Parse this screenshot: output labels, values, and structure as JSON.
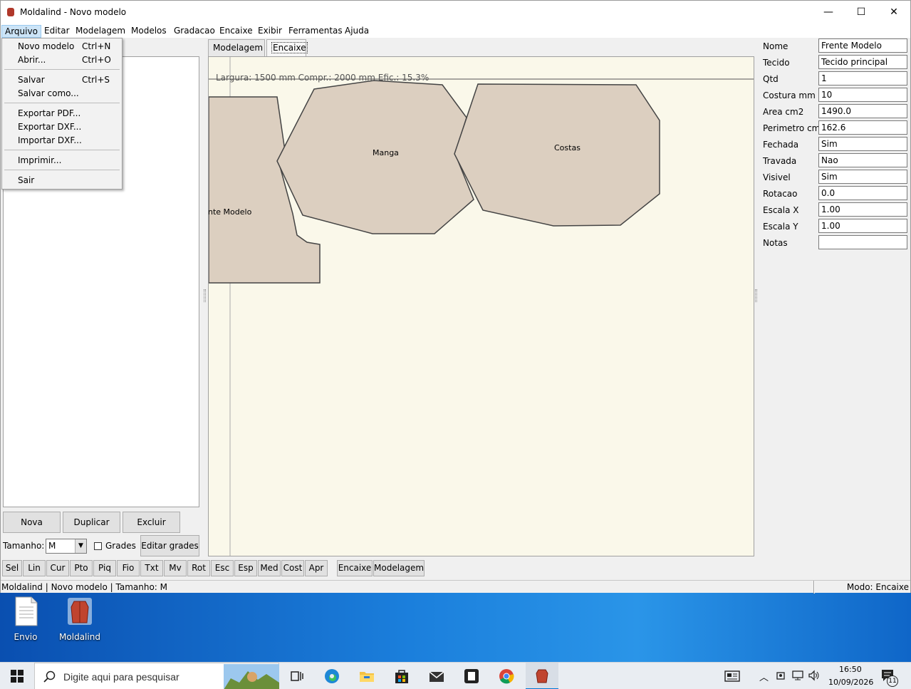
{
  "window": {
    "title": "Moldalind - Novo modelo",
    "minimize": "—",
    "maximize": "☐",
    "close": "✕"
  },
  "menubar": [
    "Arquivo",
    "Editar",
    "Modelagem",
    "Modelos",
    "Gradacao",
    "Encaixe",
    "Exibir",
    "Ferramentas",
    "Ajuda"
  ],
  "file_menu": {
    "items": [
      {
        "label": "Novo modelo",
        "shortcut": "Ctrl+N"
      },
      {
        "label": "Abrir...",
        "shortcut": "Ctrl+O"
      },
      {
        "label": "Salvar",
        "shortcut": "Ctrl+S"
      },
      {
        "label": "Salvar como...",
        "shortcut": ""
      },
      {
        "label": "Exportar PDF...",
        "shortcut": ""
      },
      {
        "label": "Exportar DXF...",
        "shortcut": ""
      },
      {
        "label": "Importar DXF...",
        "shortcut": ""
      },
      {
        "label": "Imprimir...",
        "shortcut": ""
      },
      {
        "label": "Sair",
        "shortcut": ""
      }
    ]
  },
  "left_panel": {
    "buttons": {
      "nova": "Nova",
      "duplicar": "Duplicar",
      "excluir": "Excluir"
    },
    "tamanho_label": "Tamanho:",
    "tamanho_value": "M",
    "grades_label": "Grades",
    "editar_grades": "Editar grades"
  },
  "tabs": [
    "Modelagem",
    "Encaixe"
  ],
  "canvas": {
    "info": "Largura: 1500 mm   Compr.: 2000 mm   Efic.: 15.3%",
    "pieces": [
      {
        "name": "nte Modelo"
      },
      {
        "name": "Manga"
      },
      {
        "name": "Costas"
      }
    ]
  },
  "properties": [
    {
      "label": "Nome",
      "value": "Frente Modelo"
    },
    {
      "label": "Tecido",
      "value": "Tecido principal"
    },
    {
      "label": "Qtd",
      "value": "1"
    },
    {
      "label": "Costura mm",
      "value": "10"
    },
    {
      "label": "Area cm2",
      "value": "1490.0"
    },
    {
      "label": "Perimetro cm",
      "value": "162.6"
    },
    {
      "label": "Fechada",
      "value": "Sim"
    },
    {
      "label": "Travada",
      "value": "Nao"
    },
    {
      "label": "Visivel",
      "value": "Sim"
    },
    {
      "label": "Rotacao",
      "value": "0.0"
    },
    {
      "label": "Escala X",
      "value": "1.00"
    },
    {
      "label": "Escala Y",
      "value": "1.00"
    },
    {
      "label": "Notas",
      "value": ""
    }
  ],
  "toolbar": [
    "Sel",
    "Lin",
    "Cur",
    "Pto",
    "Piq",
    "Fio",
    "Txt",
    "Mv",
    "Rot",
    "Esc",
    "Esp",
    "Med",
    "Cost",
    "Apr",
    "Encaixe",
    "Modelagem"
  ],
  "statusbar": {
    "left": "Moldalind | Novo modelo | Tamanho: M",
    "right": "Modo: Encaixe"
  },
  "desktop_icons": [
    {
      "label": "Envio"
    },
    {
      "label": "Moldalind"
    }
  ],
  "taskbar": {
    "search_placeholder": "Digite aqui para pesquisar",
    "time": "16:50",
    "date": "10/09/2026",
    "notifications": "11"
  },
  "colors": {
    "piece_fill": "#dccfc0",
    "canvas_bg": "#faf8ea",
    "accent": "#0078d7"
  }
}
